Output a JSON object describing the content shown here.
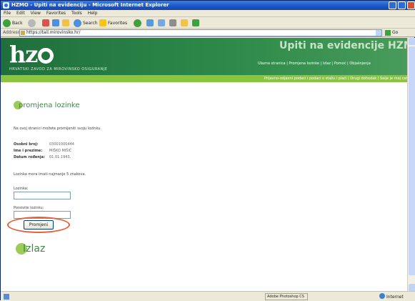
{
  "window": {
    "title": "HZMO - Upiti na evidenciju - Microsoft Internet Explorer"
  },
  "menu": [
    "File",
    "Edit",
    "View",
    "Favorites",
    "Tools",
    "Help"
  ],
  "toolbar": {
    "back": "Back",
    "search": "Search",
    "favorites": "Favorites"
  },
  "address": {
    "label": "Address",
    "url": "https://tail.mirovinsko.hr/",
    "go": "Go"
  },
  "site": {
    "logo": "hz",
    "institution": "HRVATSKI ZAVOD ZA MIROVINSKO OSIGURANJE",
    "title": "Upiti na evidencije HZMO-a",
    "topnav": "Ulazna stranica | Promjena lozinke | Izlaz | Pomoć | Objašnjenja",
    "subnav": "Prijavno-odjavni podaci i podaci o stažu i plaći | Drugi dohodak | Salje je moj catitpa"
  },
  "page": {
    "heading": "promjena lozinke",
    "intro": "Na ovoj stranici možete promijeniti svoju lozinku.",
    "fields": [
      {
        "label": "Osobni broj:",
        "value": "03001000444"
      },
      {
        "label": "Ime i prezime:",
        "value": "MIŠKO MIŠIĆ"
      },
      {
        "label": "Datum rođenja:",
        "value": "01.01.1943."
      }
    ],
    "rule": "Lozinka mora imati najmanje 5 znakova.",
    "password_label": "Lozinka:",
    "repeat_label": "Ponovite lozinku:",
    "submit": "Promjeni",
    "exit": "Izlaz"
  },
  "status": {
    "field": "Adobe Photoshop CS",
    "zone": "Internet"
  },
  "colors": {
    "accent": "#3a8a3f",
    "banner": "#2d8a4a",
    "highlight": "#e4603a"
  }
}
